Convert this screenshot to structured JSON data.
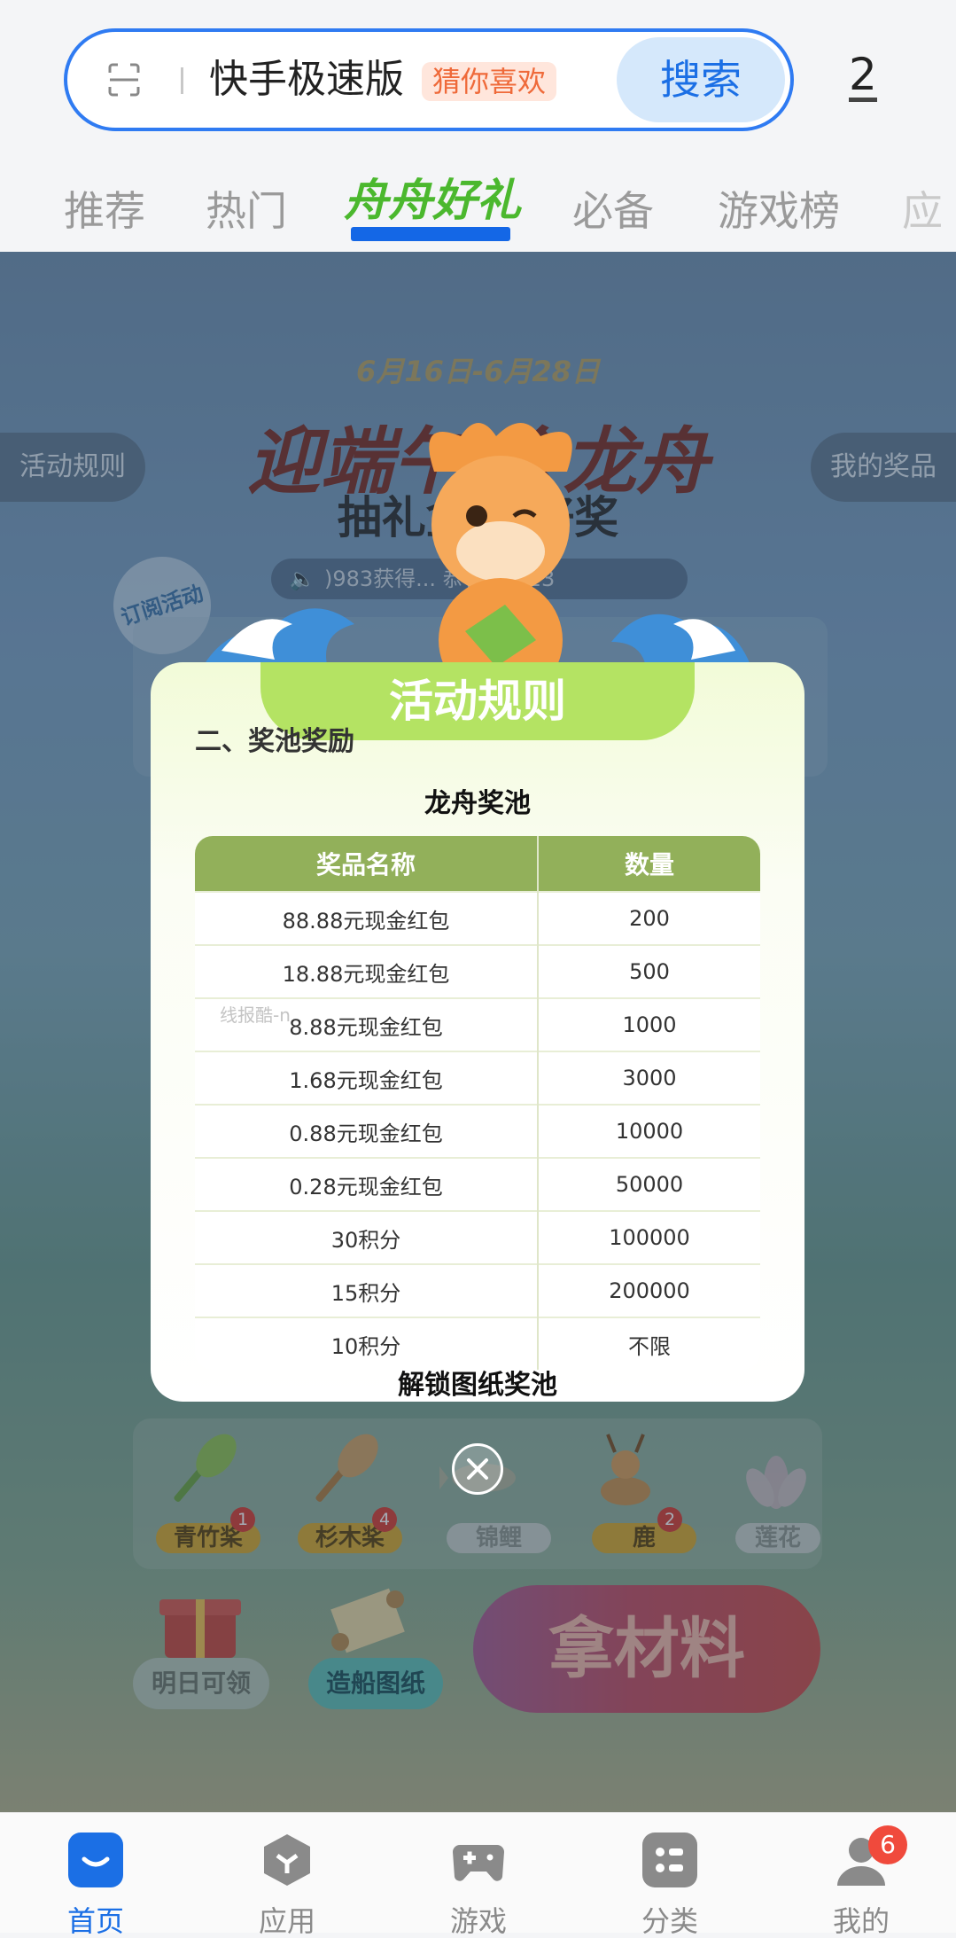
{
  "search": {
    "query": "快手极速版",
    "badge": "猜你喜欢",
    "button": "搜索",
    "download_count": "2"
  },
  "tabs": [
    {
      "label": "推荐"
    },
    {
      "label": "热门"
    },
    {
      "label": "舟舟好礼",
      "active": true
    },
    {
      "label": "必备"
    },
    {
      "label": "游戏榜"
    },
    {
      "label": "应"
    }
  ],
  "activity": {
    "date_range": "6月16日-6月28日",
    "title": "迎端午 会龙舟",
    "subtitle": "抽礼盒 赢好奖",
    "rules_button": "活动规则",
    "my_prizes_button": "我的奖品",
    "subscribe": "订阅活动",
    "ticker": ")983获得... 恭喜用户13",
    "materials": [
      {
        "name": "青竹桨",
        "count": "1"
      },
      {
        "name": "杉木桨",
        "count": "4"
      },
      {
        "name": "锦鲤",
        "count": ""
      },
      {
        "name": "鹿",
        "count": "2"
      },
      {
        "name": "莲花",
        "count": ""
      }
    ],
    "tomorrow_button": "明日可领",
    "blueprint_button": "造船图纸",
    "get_materials_button": "拿材料"
  },
  "modal": {
    "header": "活动规则",
    "section_title": "二、奖池奖励",
    "pool_title": "龙舟奖池",
    "columns": [
      "奖品名称",
      "数量"
    ],
    "rows": [
      [
        "88.88元现金红包",
        "200"
      ],
      [
        "18.88元现金红包",
        "500"
      ],
      [
        "8.88元现金红包",
        "1000"
      ],
      [
        "1.68元现金红包",
        "3000"
      ],
      [
        "0.88元现金红包",
        "10000"
      ],
      [
        "0.28元现金红包",
        "50000"
      ],
      [
        "30积分",
        "100000"
      ],
      [
        "15积分",
        "200000"
      ],
      [
        "10积分",
        "不限"
      ]
    ],
    "unlock_title": "解锁图纸奖池",
    "watermark": "线报酷-n"
  },
  "bottom_nav": [
    {
      "label": "首页",
      "icon": "home-icon",
      "active": true
    },
    {
      "label": "应用",
      "icon": "apps-icon"
    },
    {
      "label": "游戏",
      "icon": "gamepad-icon"
    },
    {
      "label": "分类",
      "icon": "category-icon"
    },
    {
      "label": "我的",
      "icon": "profile-icon",
      "badge": "6"
    }
  ],
  "colors": {
    "primary_blue": "#1b6fe5",
    "accent_green": "#4bb82e",
    "table_header": "#92b05a",
    "modal_header": "#b4e363",
    "badge_red": "#f04a3c"
  }
}
